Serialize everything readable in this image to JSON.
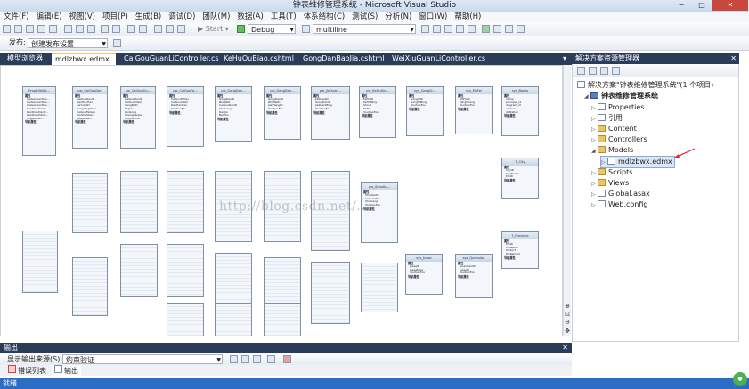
{
  "window": {
    "title": "钟表维修管理系统 - Microsoft Visual Studio"
  },
  "menu": [
    "文件(F)",
    "编辑(E)",
    "视图(V)",
    "项目(P)",
    "生成(B)",
    "调试(D)",
    "团队(M)",
    "数据(A)",
    "工具(T)",
    "体系结构(C)",
    "测试(S)",
    "分析(N)",
    "窗口(W)",
    "帮助(H)"
  ],
  "toolbar": {
    "start_label": "Start",
    "config": "Debug",
    "target": "multiline"
  },
  "publish": {
    "label": "发布:",
    "value": "创建发布设置"
  },
  "doc_tabs": [
    "模型浏览器",
    "mdlzbwx.edmx",
    "CaiGouGuanLiController.cs",
    "KeHuQuBiao.cshtml",
    "GongDanBaoJia.cshtml",
    "WeiXiuGuanLiController.cs"
  ],
  "designer": {
    "watermark": "http://blog.csdn.net/...",
    "section_props": "属性",
    "section_nav": "导航属性",
    "entities": [
      {
        "name": "EmpBillsDe...",
        "rows": [
          "CaiGaoDanHeo...",
          "CaiGaoDanHeo...",
          "CaiGaoDanHeo...",
          "KaoShouDanH...",
          "KaoShouDanH...",
          "KaoShouDanH...",
          "ShiJiaoQiao..."
        ]
      },
      {
        "name": "pw_CaiGouDan",
        "rows": [
          "CaiGouDanID",
          "DanHaoHao",
          "LaiYuanID",
          "GongYingShan",
          "CaiGouFeiGou",
          "YunShuShan",
          "KaiPiaoRen"
        ]
      },
      {
        "name": "pw_CaiGouGu...",
        "rows": [
          "CaiGouDanID",
          "CaiGouXiaQi",
          "CangKuID",
          "ShiJian",
          "DuiGong",
          "ChengBenJia",
          "YouXiaoFou"
        ]
      },
      {
        "name": "pw_CaiGouFa...",
        "rows": [
          "CaiGouFaHao",
          "CaiGouXiaQi",
          "DanHaoHao",
          "YouXiaoFou"
        ]
      },
      {
        "name": "pw_GongDan...",
        "rows": [
          "GongDanID",
          "BaoJiaID",
          "CaiGouDanID",
          "ShuLiang",
          "DanJia",
          "BeiZhu"
        ]
      },
      {
        "name": "pw_GongDan...",
        "rows": [
          "GongDanID",
          "ZhiWeiID",
          "JianHangID",
          "YouXiaoFou"
        ]
      },
      {
        "name": "pw_JieDuan...",
        "rows": [
          "JieDuanID",
          "GongDanID",
          "JieDuanMing",
          "YouXiaoFou"
        ]
      },
      {
        "name": "pw_KeHuXin...",
        "rows": [
          "KeHuID",
          "KeHuMing",
          "ShouJi",
          "DiZhi",
          "YouXiaoFou"
        ]
      },
      {
        "name": "sys_GongSi...",
        "rows": [
          "GongSiID",
          "GongSiMing",
          "YouXiaoFou"
        ]
      },
      {
        "name": "sys_MoFei",
        "rows": [
          "MoFeiID",
          "MingCheng",
          "YouXiaoFou"
        ]
      },
      {
        "name": "sys_Boxes",
        "rows": [
          "name",
          "principal_id",
          "diagram_id",
          "version",
          "definition"
        ]
      },
      {
        "name": "T_City",
        "rows": [
          "CityID",
          "CityName",
          "ProID"
        ]
      },
      {
        "name": "pw_ShouKu...",
        "rows": [
          "ShouKuID",
          "LaiYuanID",
          "ShuLiang",
          "YouXiaoFou"
        ]
      },
      {
        "name": "T_Province",
        "rows": [
          "ProID",
          "ProName",
          "ProSort",
          "ProRemark"
        ]
      },
      {
        "name": "sys_Juese",
        "rows": [
          "JueseID",
          "JueseMing",
          "YouXiaoFou"
        ]
      },
      {
        "name": "sys_Quanxian",
        "rows": [
          "QuanXianID",
          "JueseID",
          "YouXiaoFou"
        ]
      }
    ]
  },
  "solution": {
    "header": "解决方案资源管理器",
    "root": "解决方案\"钟表维修管理系统\"(1 个项目)",
    "project": "钟表维修管理系统",
    "items": [
      "Properties",
      "引用",
      "Content",
      "Controllers",
      "Models",
      "mdlzbwx.edmx",
      "Scripts",
      "Views",
      "Global.asax",
      "Web.config"
    ]
  },
  "output": {
    "header": "输出",
    "source_label": "显示输出来源(S):",
    "source_value": "约束验证",
    "tabs": [
      "错误列表",
      "输出"
    ]
  },
  "status": {
    "text": "就绪"
  }
}
